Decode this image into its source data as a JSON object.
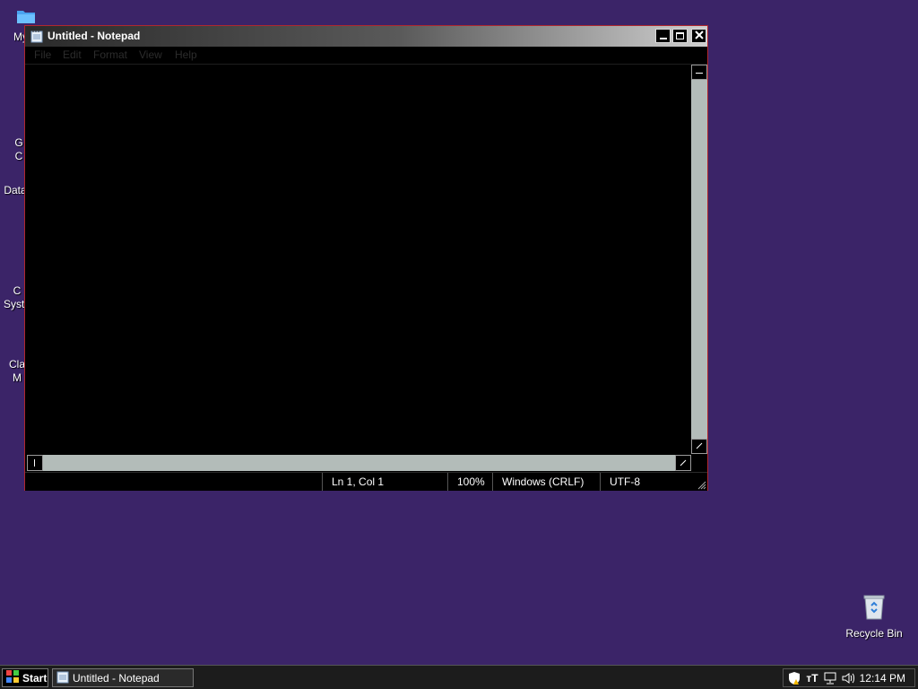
{
  "desktop": {
    "icons": [
      {
        "label": "My C"
      },
      {
        "label": "G\nC"
      },
      {
        "label": "Data"
      },
      {
        "label": "C\nSyste"
      },
      {
        "label": "Cla\nM"
      }
    ],
    "recycle_bin": {
      "label": "Recycle Bin",
      "icon": "recycle-bin-icon"
    }
  },
  "window": {
    "title": "Untitled - Notepad",
    "icon": "notepad-icon",
    "controls": {
      "minimize": "minimize-icon",
      "maximize": "maximize-icon",
      "close": "close-icon"
    },
    "menu": [
      "File",
      "Edit",
      "Format",
      "View",
      "Help"
    ],
    "document_text": "",
    "status": {
      "position": "Ln 1, Col 1",
      "zoom": "100%",
      "line_endings": "Windows (CRLF)",
      "encoding": "UTF-8"
    },
    "colors": {
      "frame_border": "#b0282e",
      "background": "#000000",
      "scrollbar": "#b3bcb9"
    }
  },
  "taskbar": {
    "start_label": "Start",
    "tasks": [
      {
        "label": "Untitled - Notepad",
        "icon": "notepad-icon"
      }
    ],
    "tray_icons": [
      "security-shield-icon",
      "language-icon",
      "network-icon",
      "volume-icon"
    ],
    "clock": "12:14 PM"
  },
  "desktop_color": "#3b2468"
}
